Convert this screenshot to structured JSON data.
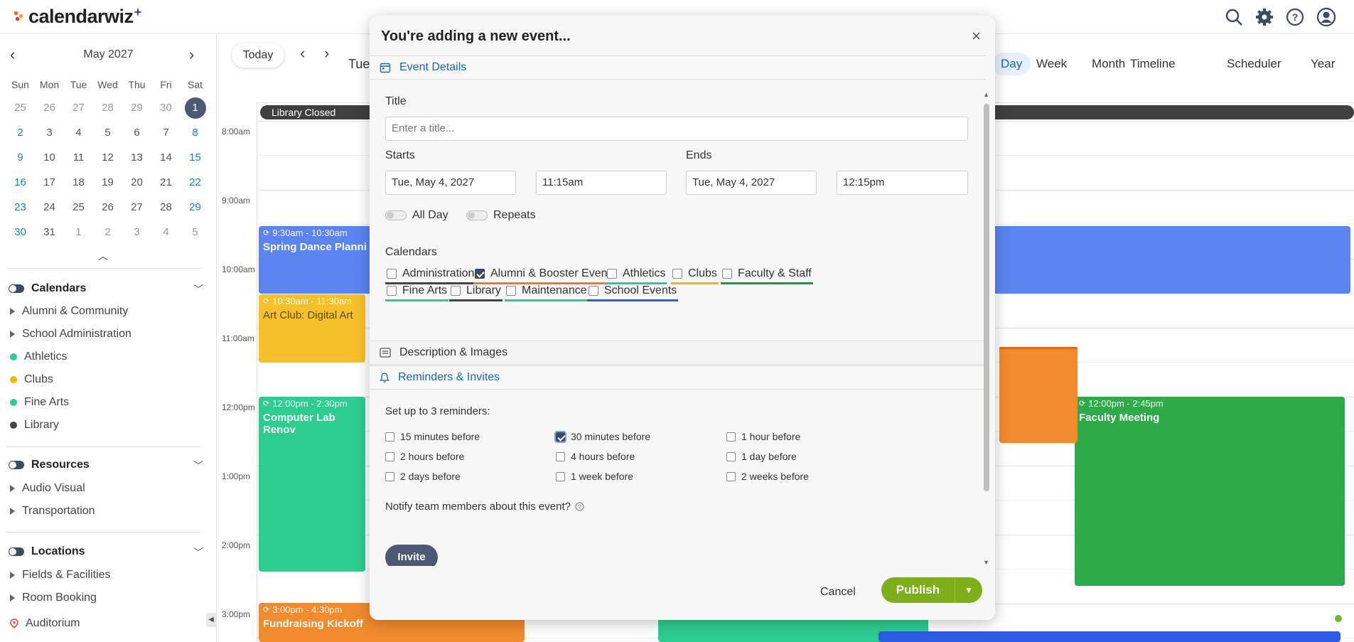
{
  "app": {
    "brand": "calendarwiz",
    "brand_plus": "+"
  },
  "header_icons": [
    "search-icon",
    "gear-icon",
    "help-icon",
    "account-icon"
  ],
  "mini_cal": {
    "month_label": "May 2027",
    "dows": [
      "Sun",
      "Mon",
      "Tue",
      "Wed",
      "Thu",
      "Fri",
      "Sat"
    ],
    "days": [
      "25",
      "26",
      "27",
      "28",
      "29",
      "30",
      "1",
      "2",
      "3",
      "4",
      "5",
      "6",
      "7",
      "8",
      "9",
      "10",
      "11",
      "12",
      "13",
      "14",
      "15",
      "16",
      "17",
      "18",
      "19",
      "20",
      "21",
      "22",
      "23",
      "24",
      "25",
      "26",
      "27",
      "28",
      "29",
      "30",
      "31",
      "1",
      "2",
      "3",
      "4",
      "5"
    ],
    "selected": "1"
  },
  "sidebar": {
    "calendars_title": "Calendars",
    "calendar_items": [
      {
        "label": "Alumni & Community",
        "kind": "group"
      },
      {
        "label": "School Administration",
        "kind": "group"
      },
      {
        "label": "Athletics",
        "kind": "dot",
        "color": "#2ecc8f"
      },
      {
        "label": "Clubs",
        "kind": "dot",
        "color": "#f2b600"
      },
      {
        "label": "Fine Arts",
        "kind": "dot",
        "color": "#2ecc8f"
      },
      {
        "label": "Library",
        "kind": "dot",
        "color": "#444444"
      }
    ],
    "resources_title": "Resources",
    "resource_items": [
      "Audio Visual",
      "Transportation"
    ],
    "locations_title": "Locations",
    "location_items": [
      "Fields & Facilities",
      "Room Booking"
    ],
    "location_pin_item": "Auditorium"
  },
  "toolbar": {
    "today": "Today",
    "date_partial": "Tue",
    "views": [
      "Day",
      "Week",
      "Month",
      "Timeline",
      "Scheduler",
      "Year"
    ]
  },
  "dayview": {
    "allday_event": "Library Closed",
    "times": [
      "8:00am",
      "9:00am",
      "10:00am",
      "11:00am",
      "12:00pm",
      "1:00pm",
      "2:00pm",
      "3:00pm"
    ],
    "events": [
      {
        "time": "9:30am - 10:30am",
        "title": "Spring Dance Planni",
        "color": "#5b84f0"
      },
      {
        "time": "10:30am - 11:30am",
        "title": "Art Club: Digital Art",
        "color": "#f5c02a"
      },
      {
        "time": "12:00pm - 2:30pm",
        "title": "Computer Lab Renov",
        "color": "#2ecc8f"
      },
      {
        "time": "12:00pm - 2:45pm",
        "title": "Faculty Meeting",
        "color": "#2faa4a"
      },
      {
        "time": "3:00pm - 4:30pm",
        "title": "Fundraising Kickoff",
        "color": "#f28a2e"
      }
    ]
  },
  "modal": {
    "title": "You're adding a new event...",
    "section_details": "Event Details",
    "title_label": "Title",
    "title_placeholder": "Enter a title...",
    "starts_label": "Starts",
    "ends_label": "Ends",
    "start_date": "Tue, May 4, 2027",
    "start_time": "11:15am",
    "end_date": "Tue, May 4, 2027",
    "end_time": "12:15pm",
    "allday_label": "All Day",
    "repeats_label": "Repeats",
    "calendars_label": "Calendars",
    "calendars": [
      {
        "label": "Administration",
        "checked": false,
        "color": "#444444"
      },
      {
        "label": "Alumni & Booster Events",
        "checked": true,
        "color": "#f07a2a"
      },
      {
        "label": "Athletics",
        "checked": false,
        "color": "#2ecc8f"
      },
      {
        "label": "Clubs",
        "checked": false,
        "color": "#f2b600"
      },
      {
        "label": "Faculty & Staff",
        "checked": false,
        "color": "#1a9a3a"
      },
      {
        "label": "Fine Arts",
        "checked": false,
        "color": "#2ecc8f"
      },
      {
        "label": "Library",
        "checked": false,
        "color": "#444444"
      },
      {
        "label": "Maintenance",
        "checked": false,
        "color": "#2ecc8f"
      },
      {
        "label": "School Events",
        "checked": false,
        "color": "#2d5be3"
      }
    ],
    "section_description": "Description & Images",
    "section_reminders": "Reminders & Invites",
    "reminders_label": "Set up to 3 reminders:",
    "reminders": [
      {
        "label": "15 minutes before",
        "checked": false
      },
      {
        "label": "30 minutes before",
        "checked": true
      },
      {
        "label": "1 hour before",
        "checked": false
      },
      {
        "label": "2 hours before",
        "checked": false
      },
      {
        "label": "4 hours before",
        "checked": false
      },
      {
        "label": "1 day before",
        "checked": false
      },
      {
        "label": "2 days before",
        "checked": false
      },
      {
        "label": "1 week before",
        "checked": false
      },
      {
        "label": "2 weeks before",
        "checked": false
      }
    ],
    "notify_label": "Notify team members about this event?",
    "invite_button": "Invite",
    "cancel_button": "Cancel",
    "publish_button": "Publish"
  }
}
